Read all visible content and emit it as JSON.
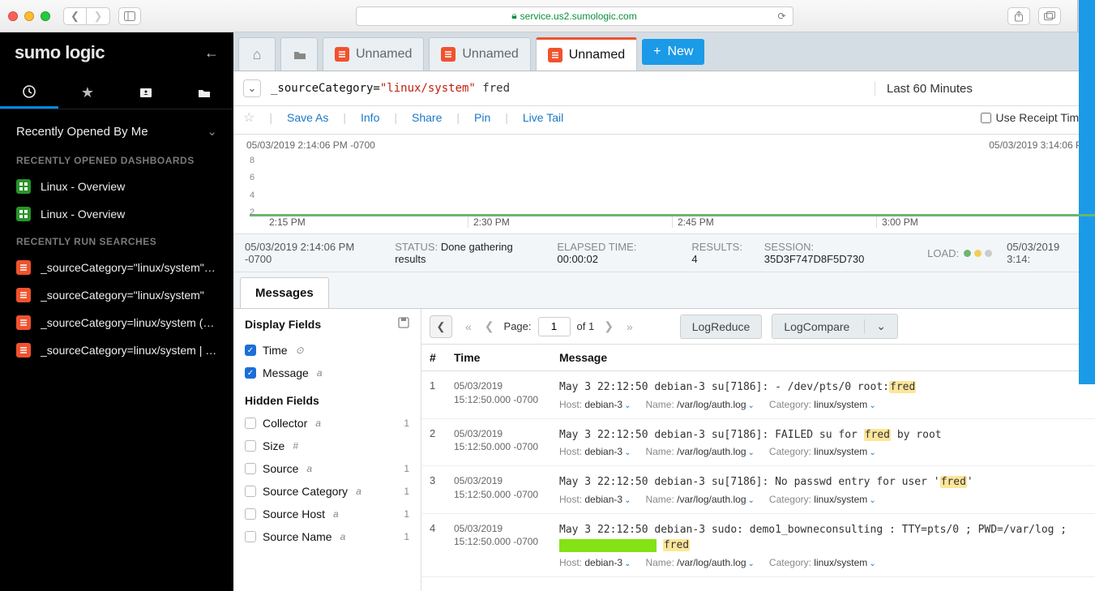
{
  "browser": {
    "url": "service.us2.sumologic.com"
  },
  "sidebar": {
    "logo": "sumo logic",
    "dropdown": "Recently Opened By Me",
    "sections": [
      {
        "title": "RECENTLY OPENED DASHBOARDS",
        "items": [
          {
            "label": "Linux - Overview",
            "kind": "dash"
          },
          {
            "label": "Linux - Overview",
            "kind": "dash"
          }
        ]
      },
      {
        "title": "RECENTLY RUN SEARCHES",
        "items": [
          {
            "label": "_sourceCategory=\"linux/system\" fr...",
            "kind": "search"
          },
          {
            "label": "_sourceCategory=\"linux/system\"",
            "kind": "search"
          },
          {
            "label": "_sourceCategory=linux/system (\"s...",
            "kind": "search"
          },
          {
            "label": "_sourceCategory=linux/system | p...",
            "kind": "search"
          }
        ]
      }
    ]
  },
  "tabs": [
    {
      "label": "Unnamed",
      "active": false
    },
    {
      "label": "Unnamed",
      "active": false
    },
    {
      "label": "Unnamed",
      "active": true
    }
  ],
  "new_tab_label": "New",
  "query": {
    "key": "_sourceCategory=",
    "str": "\"linux/system\"",
    "plain": " fred",
    "time_range": "Last 60 Minutes",
    "receipt_time_label": "Use Receipt Time",
    "actions": [
      "Save As",
      "Info",
      "Share",
      "Pin",
      "Live Tail"
    ]
  },
  "timeline": {
    "start_label": "05/03/2019 2:14:06 PM -0700",
    "end_label": "05/03/2019 3:14:06 P",
    "y_ticks": [
      "8",
      "6",
      "4",
      "2"
    ],
    "x_ticks": [
      "2:15 PM",
      "2:30 PM",
      "2:45 PM",
      "3:00 PM"
    ]
  },
  "status": {
    "ts": "05/03/2019 2:14:06 PM -0700",
    "status_label": "STATUS:",
    "status_value": "Done gathering results",
    "elapsed_label": "ELAPSED TIME:",
    "elapsed_value": "00:00:02",
    "results_label": "RESULTS:",
    "results_value": "4",
    "session_label": "SESSION:",
    "session_value": "35D3F747D8F5D730",
    "load_label": "LOAD:",
    "right_ts": "05/03/2019 3:14:"
  },
  "messages_tab": "Messages",
  "display_fields_label": "Display Fields",
  "hidden_fields_label": "Hidden Fields",
  "display_fields": [
    {
      "label": "Time",
      "type": "⊙",
      "checked": true
    },
    {
      "label": "Message",
      "type": "a",
      "checked": true
    }
  ],
  "hidden_fields": [
    {
      "label": "Collector",
      "type": "a",
      "count": "1"
    },
    {
      "label": "Size",
      "type": "#",
      "count": ""
    },
    {
      "label": "Source",
      "type": "a",
      "count": "1"
    },
    {
      "label": "Source Category",
      "type": "a",
      "count": "1"
    },
    {
      "label": "Source Host",
      "type": "a",
      "count": "1"
    },
    {
      "label": "Source Name",
      "type": "a",
      "count": "1"
    }
  ],
  "paging": {
    "page_label": "Page:",
    "page_value": "1",
    "of_label": "of 1"
  },
  "btn_logreduce": "LogReduce",
  "btn_logcompare": "LogCompare",
  "table_headers": {
    "num": "#",
    "time": "Time",
    "message": "Message"
  },
  "rows": [
    {
      "n": "1",
      "date": "05/03/2019",
      "ts": "15:12:50.000 -0700",
      "pre": "May  3 22:12:50 debian-3 su[7186]: - /dev/pts/0 root:",
      "hl": "fred",
      "post": "",
      "host": "debian-3",
      "name": "/var/log/auth.log",
      "category": "linux/system"
    },
    {
      "n": "2",
      "date": "05/03/2019",
      "ts": "15:12:50.000 -0700",
      "pre": "May  3 22:12:50 debian-3 su[7186]: FAILED su for ",
      "hl": "fred",
      "post": " by root",
      "host": "debian-3",
      "name": "/var/log/auth.log",
      "category": "linux/system"
    },
    {
      "n": "3",
      "date": "05/03/2019",
      "ts": "15:12:50.000 -0700",
      "pre": "May  3 22:12:50 debian-3 su[7186]: No passwd entry for user '",
      "hl": "fred",
      "post": "'",
      "host": "debian-3",
      "name": "/var/log/auth.log",
      "category": "linux/system"
    },
    {
      "n": "4",
      "date": "05/03/2019",
      "ts": "15:12:50.000 -0700",
      "pre": "May  3 22:12:50 debian-3 sudo: demo1_bowneconsulting : TTY=pts/0 ; PWD=/var/log ;",
      "green_block": true,
      "hl": "fred",
      "post": "",
      "host": "debian-3",
      "name": "/var/log/auth.log",
      "category": "linux/system"
    }
  ],
  "meta_labels": {
    "host": "Host:",
    "name": "Name:",
    "category": "Category:"
  }
}
